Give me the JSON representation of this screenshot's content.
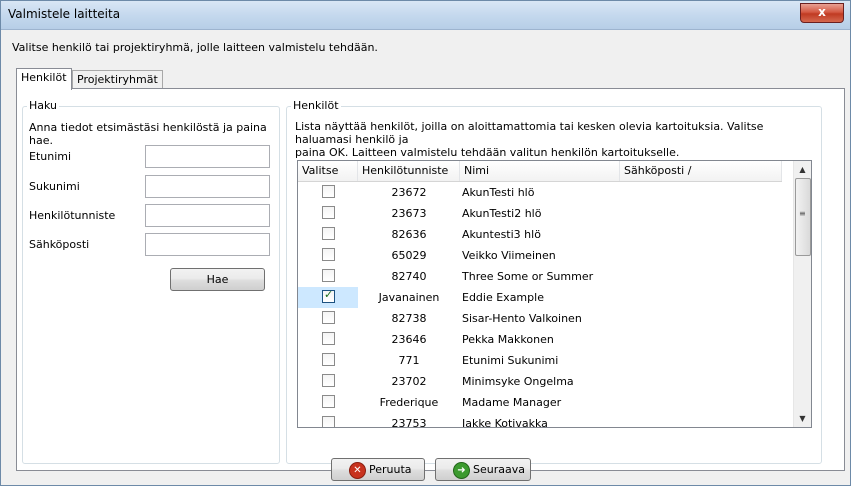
{
  "window": {
    "title": "Valmistele laitteita",
    "close_glyph": "x"
  },
  "instruction": "Valitse henkilö tai projektiryhmä, jolle laitteen valmistelu tehdään.",
  "tabs": [
    {
      "label": "Henkilöt"
    },
    {
      "label": "Projektiryhmät"
    }
  ],
  "search": {
    "title": "Haku",
    "description": "Anna tiedot etsimästäsi henkilöstä ja paina hae.",
    "fields": [
      {
        "label": "Etunimi",
        "value": ""
      },
      {
        "label": "Sukunimi",
        "value": ""
      },
      {
        "label": "Henkilötunniste",
        "value": ""
      },
      {
        "label": "Sähköposti",
        "value": ""
      }
    ],
    "button": "Hae"
  },
  "persons": {
    "title": "Henkilöt",
    "description_line1": "Lista näyttää henkilöt, joilla on aloittamattomia tai kesken olevia kartoituksia. Valitse haluamasi henkilö ja",
    "description_line2": "paina OK. Laitteen valmistelu tehdään valitun henkilön kartoitukselle.",
    "columns": [
      "Valitse",
      "Henkilötunniste",
      "Nimi",
      "Sähköposti /"
    ],
    "rows": [
      {
        "checked": false,
        "id": "23672",
        "name": "AkunTesti hlö"
      },
      {
        "checked": false,
        "id": "23673",
        "name": "AkunTesti2 hlö"
      },
      {
        "checked": false,
        "id": "82636",
        "name": "Akuntesti3 hlö"
      },
      {
        "checked": false,
        "id": "65029",
        "name": "Veikko Viimeinen"
      },
      {
        "checked": false,
        "id": "82740",
        "name": "Three Some or Summer"
      },
      {
        "checked": true,
        "id": "Javanainen",
        "name": "Eddie Example"
      },
      {
        "checked": false,
        "id": "82738",
        "name": "Sisar-Hento Valkoinen"
      },
      {
        "checked": false,
        "id": "23646",
        "name": "Pekka Makkonen"
      },
      {
        "checked": false,
        "id": "771",
        "name": "Etunimi Sukunimi"
      },
      {
        "checked": false,
        "id": "23702",
        "name": "Minimsyke Ongelma"
      },
      {
        "checked": false,
        "id": "Frederique",
        "name": "Madame Manager"
      },
      {
        "checked": false,
        "id": "23753",
        "name": "Jakke Kotivakka"
      }
    ]
  },
  "footer": {
    "cancel": "Peruuta",
    "next": "Seuraava"
  },
  "icons": {
    "cancel": "red-x-circle-icon",
    "next": "green-arrow-circle-icon"
  }
}
